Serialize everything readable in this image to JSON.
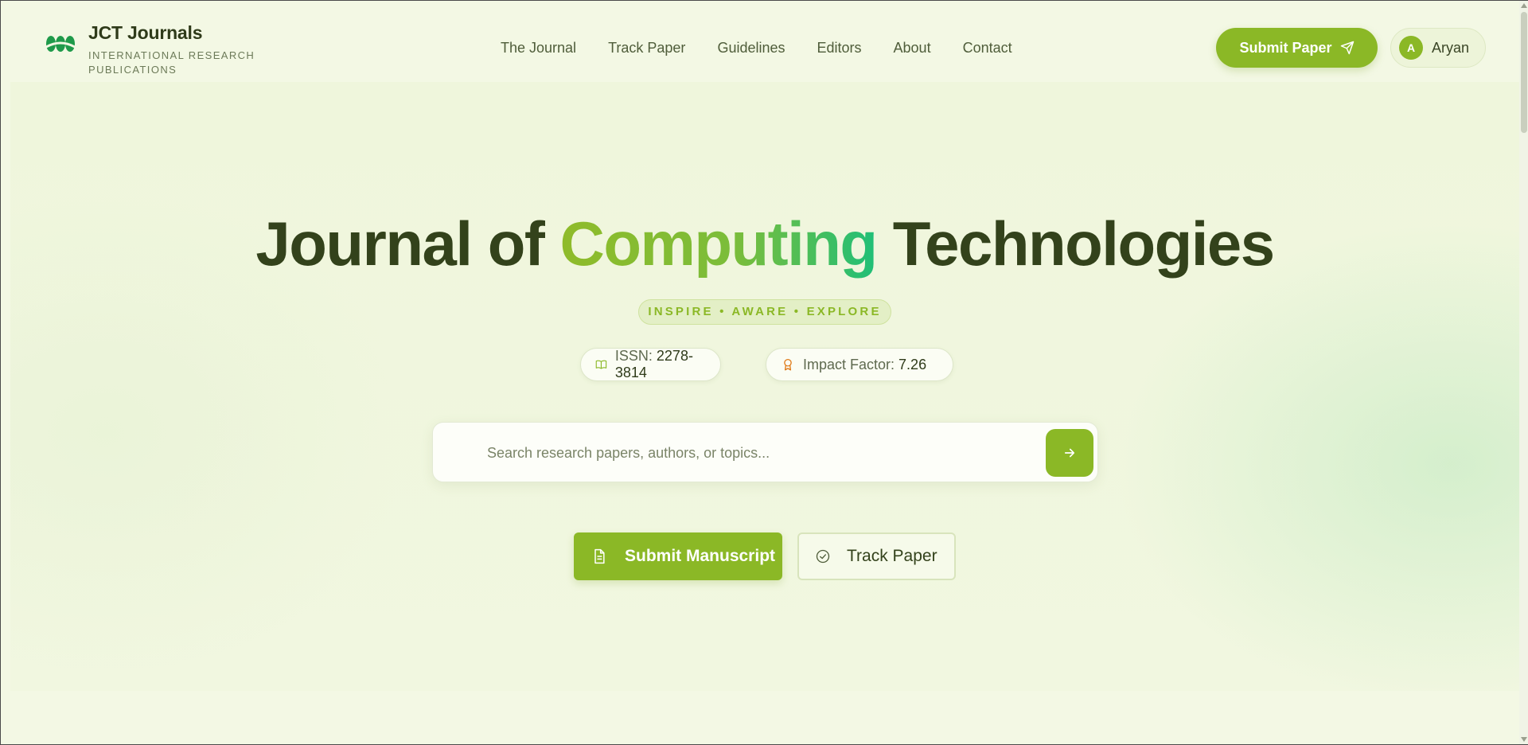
{
  "brand": {
    "name": "JCT Journals",
    "tagline": "International Research Publications",
    "logo_icon": "leaf-logo-icon",
    "logo_color": "#1f9a4a"
  },
  "nav": {
    "items": [
      {
        "label": "The Journal"
      },
      {
        "label": "Track Paper"
      },
      {
        "label": "Guidelines"
      },
      {
        "label": "Editors"
      },
      {
        "label": "About"
      },
      {
        "label": "Contact"
      }
    ]
  },
  "header": {
    "submit_label": "Submit Paper",
    "submit_icon": "send-icon",
    "user": {
      "initial": "A",
      "name": "Aryan"
    }
  },
  "hero": {
    "title_pre": "Journal of ",
    "title_accent": "Computing",
    "title_post": " Technologies",
    "tagline": "INSPIRE • AWARE • EXPLORE",
    "issn_label": "ISSN:",
    "issn_value": "2278-3814",
    "impact_label": "Impact Factor:",
    "impact_value": "7.26",
    "search_placeholder": "Search research papers, authors, or topics...",
    "search_value": "",
    "submit_manuscript_label": "Submit Manuscript",
    "track_paper_label": "Track Paper"
  },
  "colors": {
    "accent": "#8bb826",
    "heading": "#33421b",
    "gradient_end": "#1fbf78",
    "background": "#f3f8e4"
  }
}
